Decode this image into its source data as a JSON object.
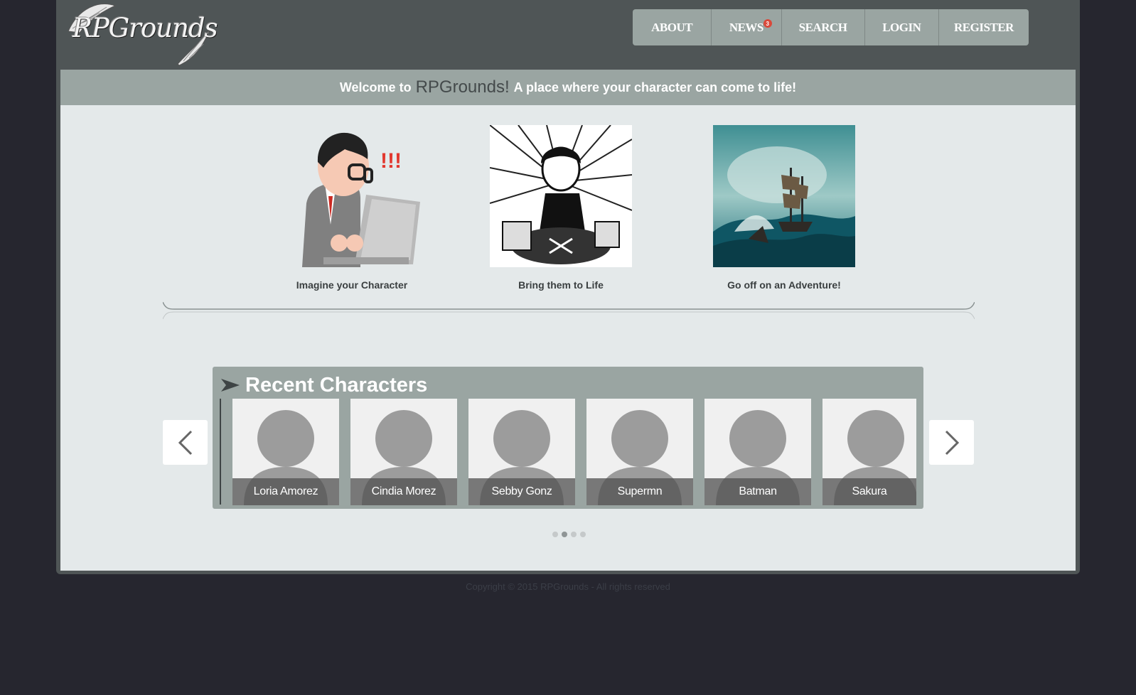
{
  "header": {
    "logo_text": "RPGrounds",
    "nav": [
      {
        "label": "ABOUT"
      },
      {
        "label": "NEWS",
        "badge": "3"
      },
      {
        "label": "SEARCH"
      },
      {
        "label": "LOGIN"
      },
      {
        "label": "REGISTER"
      }
    ]
  },
  "welcome": {
    "prefix": "Welcome to",
    "brand": "RPGrounds!",
    "suffix": "A place where your character can come to life!"
  },
  "features": [
    {
      "caption": "Imagine your Character",
      "icon": "character-at-laptop-illustration"
    },
    {
      "caption": "Bring them to Life",
      "icon": "manga-artist-illustration"
    },
    {
      "caption": "Go off on an Adventure!",
      "icon": "ship-in-storm-illustration"
    }
  ],
  "recent": {
    "title": "Recent Characters",
    "characters": [
      {
        "name": "Loria Amorez"
      },
      {
        "name": "Cindia Morez"
      },
      {
        "name": "Sebby Gonz"
      },
      {
        "name": "Supermn"
      },
      {
        "name": "Batman"
      },
      {
        "name": "Sakura"
      }
    ],
    "pagination": {
      "pages": 4,
      "active": 2
    }
  },
  "footer": {
    "copyright": "Copyright © 2015 RPGrounds - All rights reserved"
  },
  "colors": {
    "page_bg": "#26262f",
    "frame": "#4f5556",
    "accent_gray": "#9aa5a2",
    "content_bg": "#e4e9ea",
    "badge_red": "#d9493b"
  }
}
